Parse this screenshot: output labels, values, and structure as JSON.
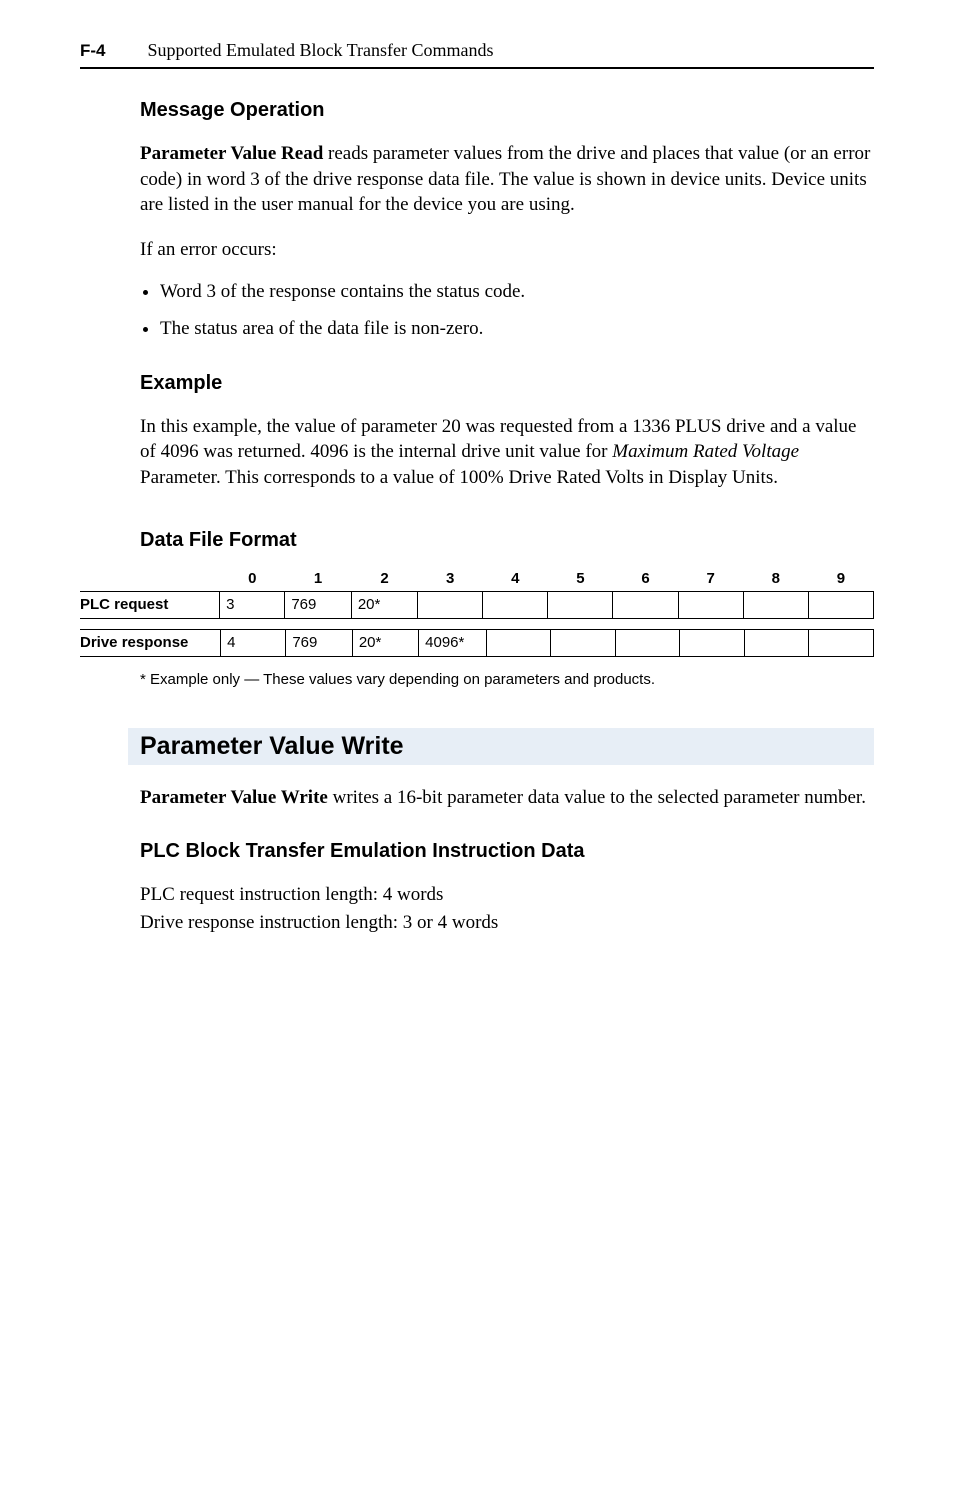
{
  "header": {
    "page_num": "F-4",
    "title": "Supported Emulated Block Transfer Commands"
  },
  "section1": {
    "heading": "Message Operation",
    "para1_a": "Parameter Value Read",
    "para1_b": " reads parameter values from the drive and places that value (or an error code) in word 3 of the drive response data file. The value is shown in device units. Device units are listed in the user manual for the device you are using.",
    "para2": "If an error occurs:",
    "bullets": [
      "Word 3 of the response contains the status code.",
      "The status area of the data file is non-zero."
    ]
  },
  "section2": {
    "heading": "Example",
    "para_a": "In this example, the value of parameter 20 was requested from a 1336 PLUS drive and a value of 4096 was returned. 4096 is the internal drive unit value for ",
    "para_italic": "Maximum Rated Voltage",
    "para_b": " Parameter. This corresponds to a value of 100% Drive Rated Volts in Display Units."
  },
  "table": {
    "heading": "Data File Format",
    "cols": [
      "0",
      "1",
      "2",
      "3",
      "4",
      "5",
      "6",
      "7",
      "8",
      "9"
    ],
    "rows": [
      {
        "label": "PLC request",
        "cells": [
          "3",
          "769",
          "20*",
          "",
          "",
          "",
          "",
          "",
          "",
          ""
        ]
      },
      {
        "label": "Drive response",
        "cells": [
          "4",
          "769",
          "20*",
          "4096*",
          "",
          "",
          "",
          "",
          "",
          ""
        ]
      }
    ],
    "footnote": "* Example only — These values vary depending on parameters and products."
  },
  "section3": {
    "band": "Parameter Value Write",
    "para_a": "Parameter Value Write",
    "para_b": " writes a 16-bit parameter data value to the selected parameter number.",
    "sub_heading": "PLC Block Transfer Emulation Instruction Data",
    "line1": "PLC request instruction length: 4 words",
    "line2": "Drive response instruction length: 3 or 4 words"
  }
}
